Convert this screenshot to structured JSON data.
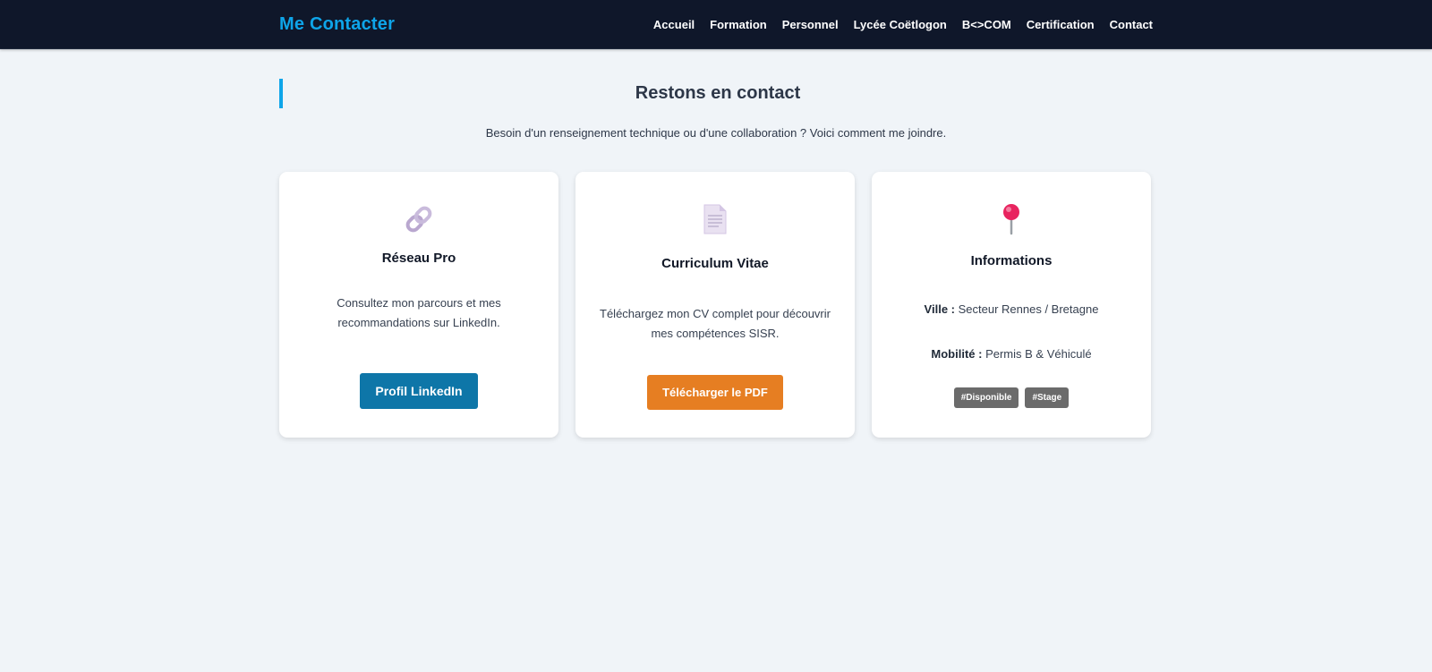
{
  "nav": {
    "brand": "Me Contacter",
    "links": [
      "Accueil",
      "Formation",
      "Personnel",
      "Lycée Coëtlogon",
      "B<>COM",
      "Certification",
      "Contact"
    ]
  },
  "header": {
    "title": "Restons en contact",
    "intro": "Besoin d'un renseignement technique ou d'une collaboration ? Voici comment me joindre."
  },
  "cards": {
    "network": {
      "icon": "link-icon",
      "title": "Réseau Pro",
      "text": "Consultez mon parcours et mes recommandations sur LinkedIn.",
      "button": "Profil LinkedIn",
      "button_color": "#0e76a8"
    },
    "cv": {
      "icon": "document-icon",
      "title": "Curriculum Vitae",
      "text": "Téléchargez mon CV complet pour découvrir mes compétences SISR.",
      "button": "Télécharger le PDF",
      "button_color": "#e67e22"
    },
    "info": {
      "icon": "pushpin-icon",
      "title": "Informations",
      "city_label": "Ville :",
      "city_value": "Secteur Rennes / Bretagne",
      "mobility_label": "Mobilité :",
      "mobility_value": "Permis B & Véhiculé",
      "tags": [
        "#Disponible",
        "#Stage"
      ]
    }
  },
  "colors": {
    "accent": "#0ea5e9",
    "navbar": "#0f172a",
    "background": "#f0f4f8"
  }
}
